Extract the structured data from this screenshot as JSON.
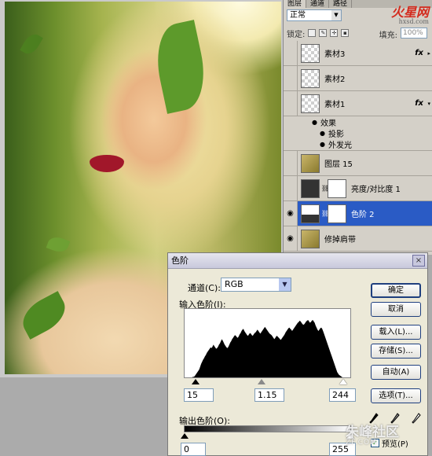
{
  "panel": {
    "tabs": [
      "图层",
      "通道",
      "路径"
    ],
    "blend_mode": "正常",
    "lock_label": "锁定:",
    "fill_label": "填充:",
    "fill_value": "100%",
    "logo_text": "火星网",
    "logo_sub": "hxsd.com",
    "layers": [
      {
        "name": "素材3",
        "thumb": "checker",
        "fx": "fx",
        "visible": false
      },
      {
        "name": "素材2",
        "thumb": "checker",
        "fx": "",
        "visible": false
      },
      {
        "name": "素材1",
        "thumb": "checker",
        "fx": "fx",
        "visible": false
      },
      {
        "name": "效果",
        "sub": true
      },
      {
        "name": "投影",
        "sub": true
      },
      {
        "name": "外发光",
        "sub": true
      },
      {
        "name": "图层 15",
        "thumb": "photo",
        "fx": "",
        "visible": false
      },
      {
        "name": "亮度/对比度 1",
        "thumb": "dark",
        "fx": "",
        "visible": false
      },
      {
        "name": "色阶 2",
        "thumb": "hist",
        "fx": "",
        "visible": true,
        "selected": true
      },
      {
        "name": "修掉肩带",
        "thumb": "photo",
        "fx": "",
        "visible": true
      }
    ]
  },
  "dialog": {
    "title": "色阶",
    "close": "×",
    "channel_label": "通道(C):",
    "channel_value": "RGB",
    "input_label": "输入色阶(I):",
    "input_values": [
      "15",
      "1.15",
      "244"
    ],
    "output_label": "输出色阶(O):",
    "output_values": [
      "0",
      "255"
    ],
    "buttons": {
      "ok": "确定",
      "cancel": "取消",
      "load": "载入(L)...",
      "save": "存储(S)...",
      "auto": "自动(A)",
      "options": "选项(T)..."
    },
    "preview_label": "预览(P)",
    "histogram": [
      2,
      2,
      3,
      3,
      4,
      6,
      8,
      10,
      12,
      14,
      18,
      22,
      25,
      28,
      30,
      33,
      35,
      38,
      40,
      42,
      44,
      46,
      45,
      47,
      50,
      48,
      46,
      44,
      45,
      47,
      50,
      52,
      55,
      58,
      56,
      53,
      50,
      48,
      46,
      45,
      47,
      50,
      53,
      55,
      58,
      60,
      62,
      64,
      63,
      61,
      60,
      62,
      65,
      67,
      70,
      72,
      73,
      70,
      68,
      66,
      64,
      63,
      65,
      67,
      66,
      64,
      63,
      65,
      67,
      68,
      70,
      72,
      70,
      68,
      66,
      68,
      70,
      72,
      74,
      76,
      74,
      72,
      70,
      68,
      66,
      65,
      64,
      62,
      60,
      58,
      60,
      62,
      63,
      61,
      60,
      58,
      57,
      59,
      61,
      63,
      65,
      68,
      70,
      72,
      74,
      75,
      73,
      72,
      70,
      72,
      74,
      76,
      78,
      80,
      82,
      83,
      85,
      84,
      82,
      80,
      79,
      80,
      82,
      84,
      85,
      86,
      84,
      82,
      83,
      85,
      86,
      84,
      82,
      78,
      75,
      72,
      70,
      72,
      74,
      75,
      73,
      70,
      66,
      62,
      58,
      54,
      50,
      46,
      42,
      38,
      34,
      30,
      26,
      22,
      18,
      14,
      10,
      8,
      6,
      5,
      4,
      3,
      2,
      2,
      1,
      1
    ]
  },
  "watermark": {
    "text": "朱峰社区",
    "sub": "ZF.COM"
  }
}
